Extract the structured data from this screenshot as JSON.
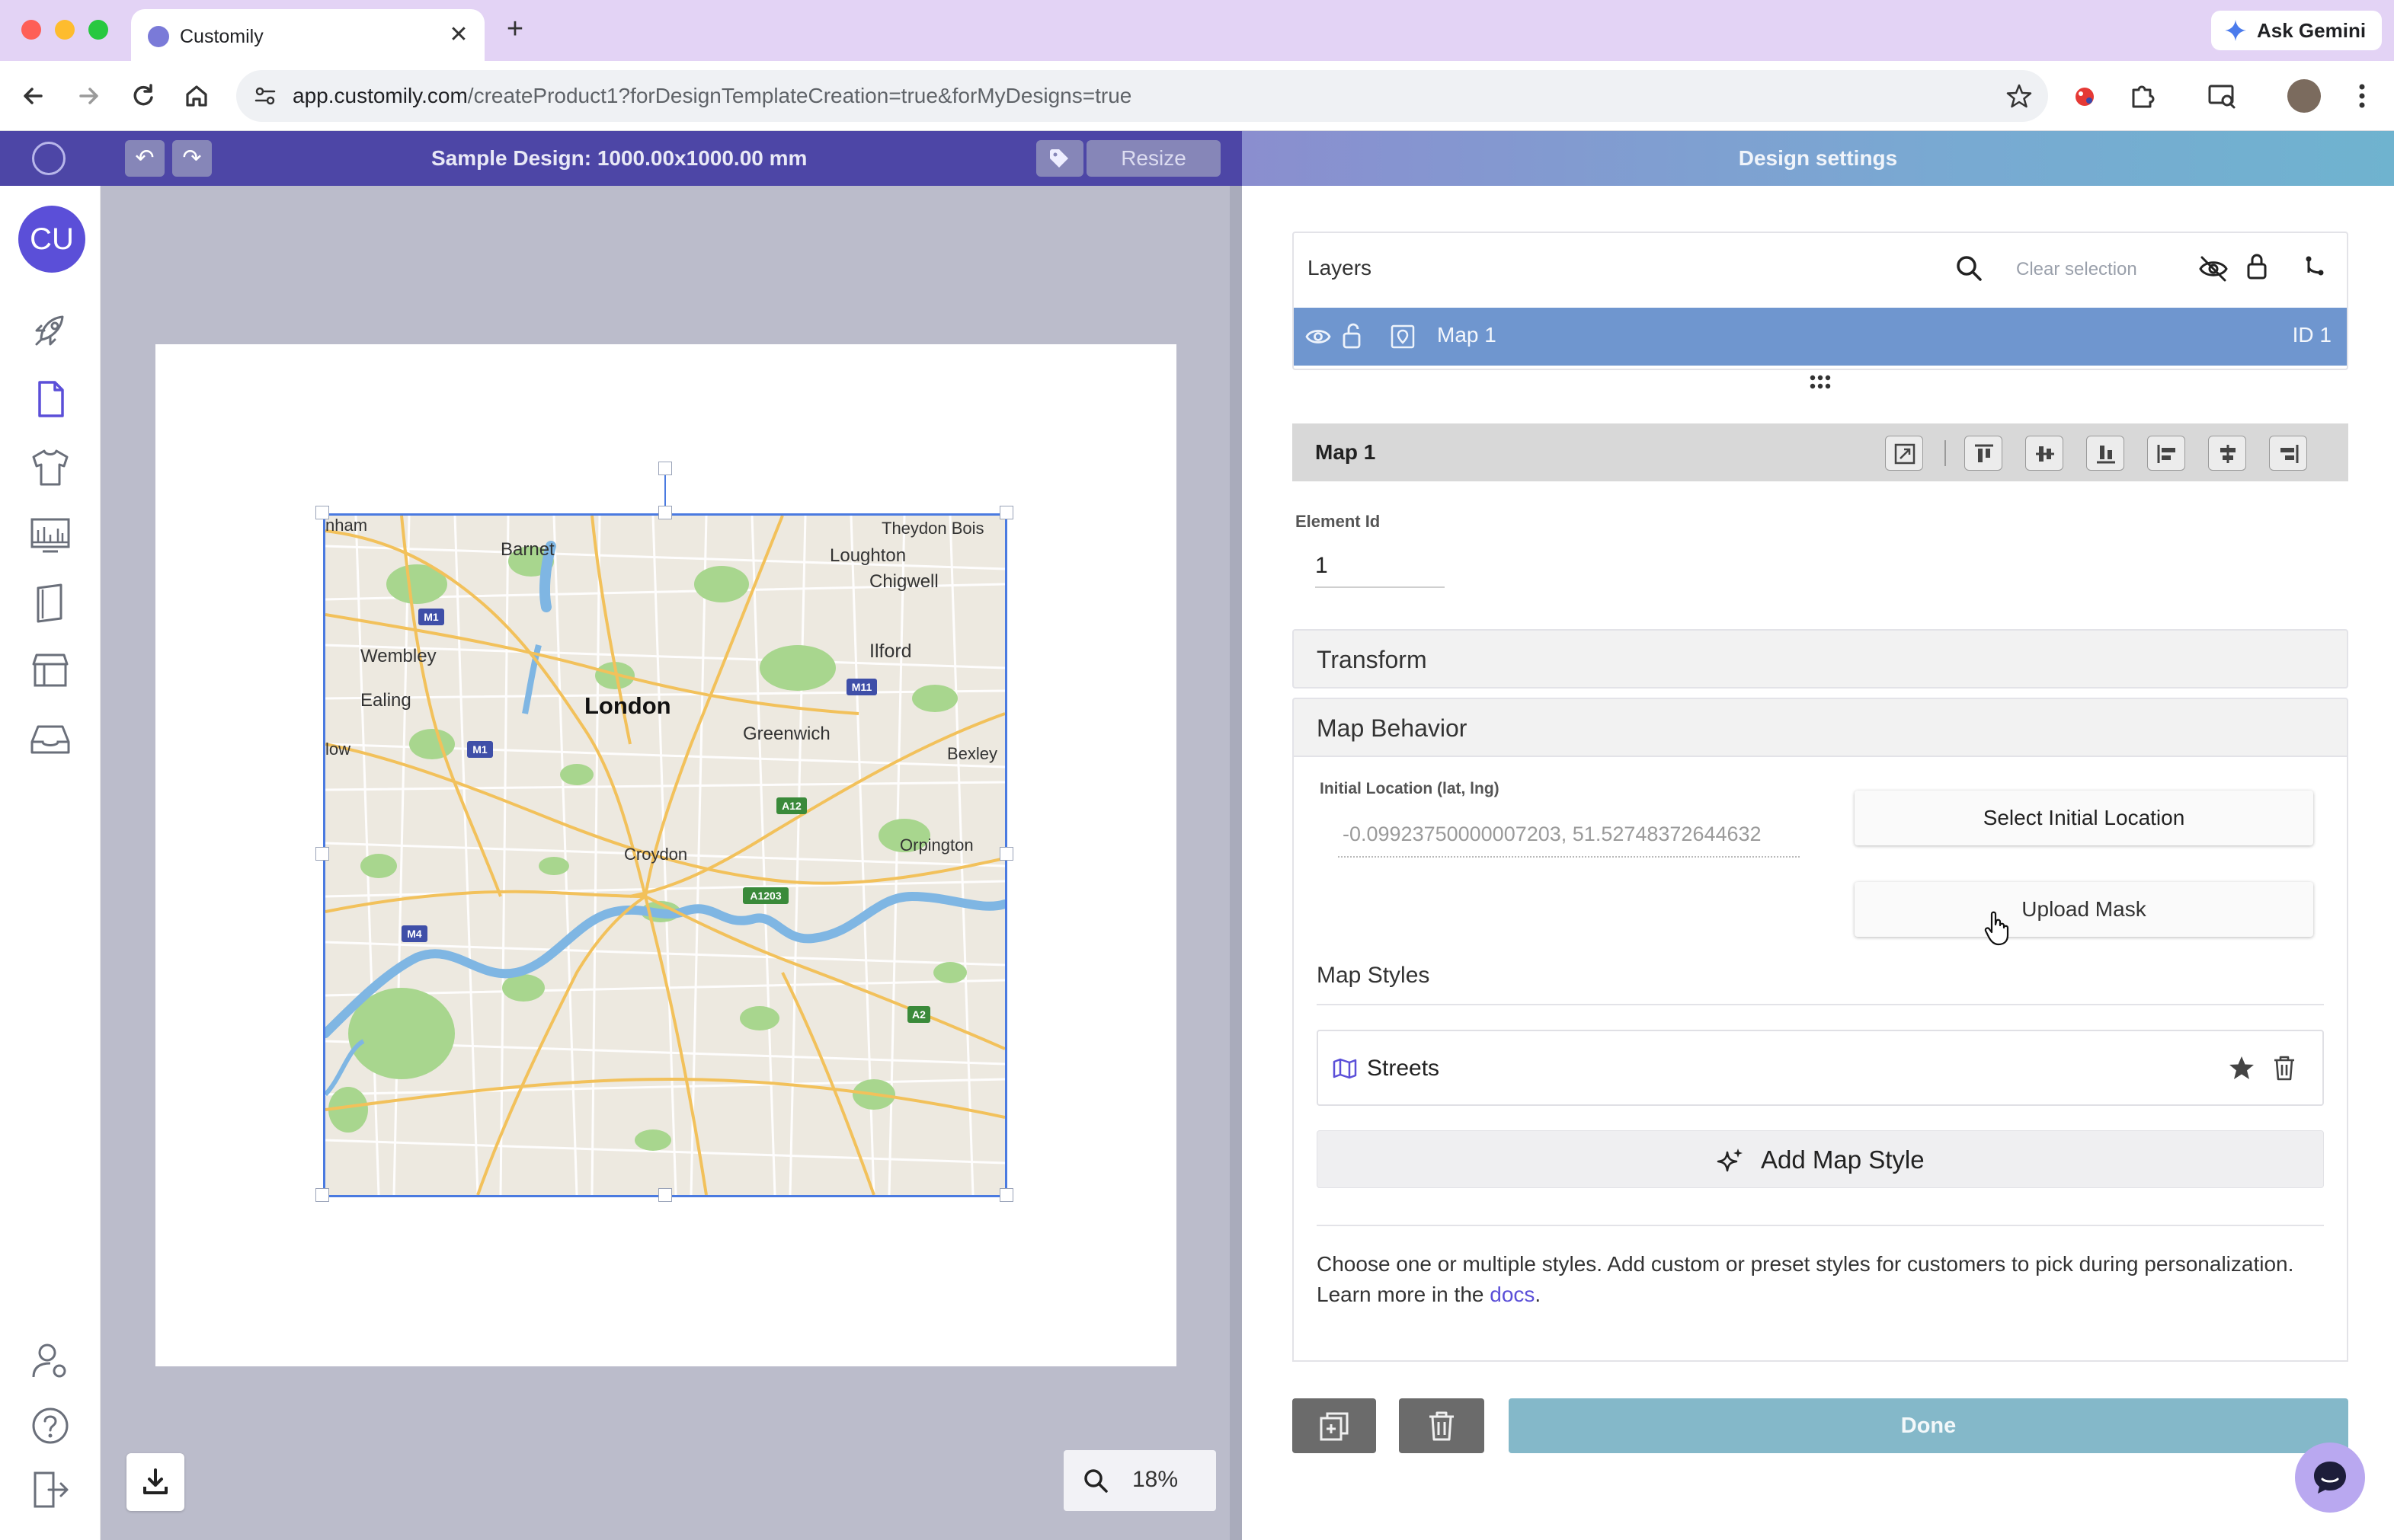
{
  "browser": {
    "tab_title": "Customily",
    "new_tab": "+",
    "close_tab": "✕",
    "gemini_label": "Ask Gemini",
    "url_host": "app.customily.com",
    "url_path": "/createProduct1?forDesignTemplateCreation=true&forMyDesigns=true"
  },
  "app_header": {
    "undo": "↶",
    "redo": "↷",
    "design_title": "Sample Design: 1000.00x1000.00 mm",
    "resize_label": "Resize",
    "settings_title": "Design settings"
  },
  "sidebar": {
    "avatar_initials": "CU",
    "items": [
      "rocket-icon",
      "document-icon",
      "tshirt-icon",
      "gallery-icon",
      "book-icon",
      "store-icon",
      "inbox-icon"
    ],
    "bottom_items": [
      "user-settings-icon",
      "help-icon",
      "logout-icon"
    ]
  },
  "canvas": {
    "zoom": "18%",
    "map_labels": {
      "ham": "nham",
      "barnet": "Barnet",
      "theydon": "Theydon Bois",
      "loughton": "Loughton",
      "chigwell": "Chigwell",
      "wembley": "Wembley",
      "ilford": "Ilford",
      "ealing": "Ealing",
      "london": "London",
      "greenwich": "Greenwich",
      "bexley": "Bexley",
      "low": "low",
      "croydon": "Croydon",
      "orpington": "Orpington"
    },
    "road_shields": {
      "m1a": "M1",
      "m1b": "M1",
      "m11": "M11",
      "a12": "A12",
      "a1203": "A1203",
      "m4": "M4",
      "a2": "A2"
    },
    "colors": {
      "land": "#ede9e0",
      "park": "#a8d68e",
      "water": "#7fb6e3",
      "major_road": "#f2c15b",
      "shield": "#3a8a3a",
      "motorway_shield": "#3f4fa8"
    }
  },
  "layers": {
    "title": "Layers",
    "clear_selection": "Clear selection",
    "items": [
      {
        "name": "Map 1",
        "id_label": "ID 1"
      }
    ]
  },
  "element": {
    "name": "Map 1",
    "element_id_label": "Element Id",
    "element_id_value": "1"
  },
  "sections": {
    "transform": "Transform",
    "map_behavior": "Map Behavior"
  },
  "map_behavior": {
    "initial_location_label": "Initial Location (lat, lng)",
    "initial_location_value": "-0.09923750000007203, 51.52748372644632",
    "select_location_button": "Select Initial Location",
    "upload_mask_button": "Upload Mask",
    "map_styles_label": "Map Styles",
    "styles": [
      {
        "name": "Streets"
      }
    ],
    "add_style_button": "Add Map Style",
    "help_text_before": "Choose one or multiple styles. Add custom or preset styles for customers to pick during personalization. Learn more in the ",
    "help_link": "docs",
    "help_text_after": "."
  },
  "footer": {
    "done_label": "Done"
  },
  "theme": {
    "header_purple": "#4d46a6",
    "accent_purple": "#5b4fd8",
    "layer_selected": "#6f96cf",
    "done_button": "#84b8c9"
  }
}
